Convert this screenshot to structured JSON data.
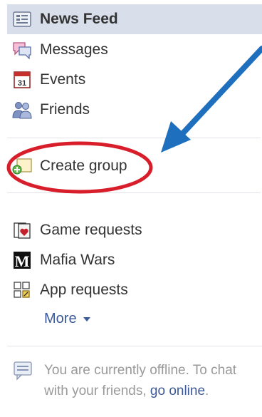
{
  "nav": {
    "items": [
      {
        "label": "News Feed",
        "icon": "news-feed-icon"
      },
      {
        "label": "Messages",
        "icon": "messages-icon"
      },
      {
        "label": "Events",
        "icon": "calendar-icon"
      },
      {
        "label": "Friends",
        "icon": "friends-icon"
      },
      {
        "label": "Create group",
        "icon": "create-group-icon"
      },
      {
        "label": "Game requests",
        "icon": "game-requests-icon"
      },
      {
        "label": "Mafia Wars",
        "icon": "mafia-wars-icon"
      },
      {
        "label": "App requests",
        "icon": "app-requests-icon"
      }
    ],
    "calendar_day": "31",
    "mafia_letter": "M",
    "more_label": "More"
  },
  "chat": {
    "offline_text": "You are currently offline. To chat with your friends,",
    "go_online_link": "go online",
    "period": "."
  },
  "annotation": {
    "arrow_color": "#1f6fbf",
    "circle_color": "#d81e2a"
  },
  "colors": {
    "link": "#3b5998",
    "highlight": "#d8dfea"
  }
}
